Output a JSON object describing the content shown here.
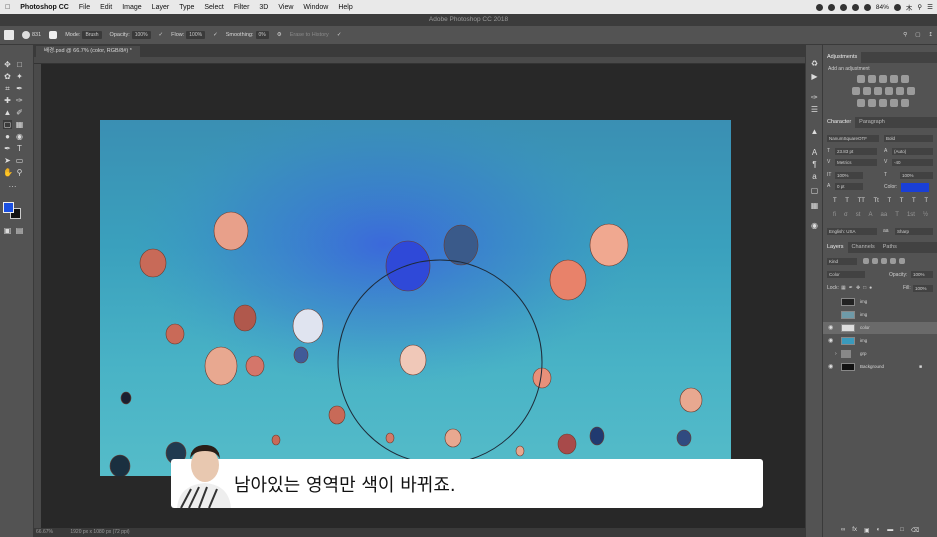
{
  "menubar": {
    "app": "Photoshop CC",
    "items": [
      "File",
      "Edit",
      "Image",
      "Layer",
      "Type",
      "Select",
      "Filter",
      "3D",
      "View",
      "Window",
      "Help"
    ],
    "battery": "84%",
    "clock": "木"
  },
  "window_title": "Adobe Photoshop CC 2018",
  "options": {
    "brush_size": "831",
    "mode_label": "Mode:",
    "mode_value": "Brush",
    "opacity_label": "Opacity:",
    "opacity_value": "100%",
    "flow_label": "Flow:",
    "flow_value": "100%",
    "smoothing_label": "Smoothing:",
    "smoothing_value": "0%",
    "erase_history": "Erase to History"
  },
  "document_tab": "배경.psd @ 66.7% (color, RGB/8#) *",
  "statusbar": {
    "zoom": "66.67%",
    "doc_info": "1920 px x 1080 px (72 ppi)"
  },
  "adjustments": {
    "tab": "Adjustments",
    "subtitle": "Add an adjustment"
  },
  "character": {
    "tabs": [
      "Character",
      "Paragraph"
    ],
    "font_family": "NanumSquareOTF",
    "font_style": "Bold",
    "font_size": "23.83 pt",
    "leading": "(Auto)",
    "kerning": "Metrics",
    "tracking": "-40",
    "vscale": "100%",
    "hscale": "100%",
    "baseline": "0 pt",
    "color_label": "Color:",
    "color": "#1a3fd6",
    "language": "English: USA",
    "antialias": "Sharp"
  },
  "layers": {
    "tabs": [
      "Layers",
      "Channels",
      "Paths"
    ],
    "filter": "Kind",
    "blend": "Color",
    "opacity_label": "Opacity:",
    "opacity": "100%",
    "lock_label": "Lock:",
    "fill_label": "Fill:",
    "fill": "100%",
    "items": [
      {
        "name": "img",
        "visible": false,
        "selected": false
      },
      {
        "name": "img",
        "visible": false,
        "selected": false
      },
      {
        "name": "color",
        "visible": true,
        "selected": true
      },
      {
        "name": "img",
        "visible": true,
        "selected": false
      },
      {
        "name": "grp",
        "visible": false,
        "selected": false
      },
      {
        "name": "Background",
        "visible": true,
        "selected": false
      }
    ]
  },
  "subtitle": "남아있는 영역만 색이 바뀌죠.",
  "colors": {
    "foreground": "#1a4fe0",
    "background": "#111111",
    "accent": "#1a3fd6"
  }
}
